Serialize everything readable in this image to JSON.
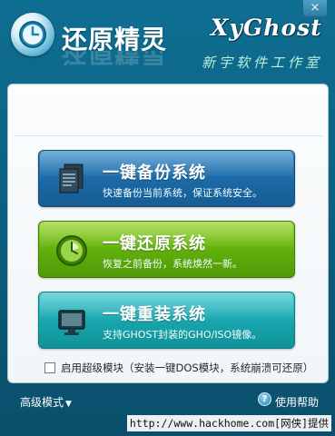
{
  "header": {
    "title": "还原精灵",
    "brand": "XyGhost",
    "brand_sub": "新宇软件工作室",
    "close_label": "×"
  },
  "actions": [
    {
      "title": "一键备份系统",
      "desc": "快速备份当前系统，保证系统安全。",
      "icon": "documents-icon"
    },
    {
      "title": "一键还原系统",
      "desc": "恢复之前备份，系统焕然一新。",
      "icon": "clock-icon"
    },
    {
      "title": "一键重装系统",
      "desc": "支持GHOST封装的GHO/ISO镜像。",
      "icon": "monitor-icon"
    }
  ],
  "options": {
    "dos_module_label": "启用超级模块（安装一键DOS模块，系统崩溃可还原）",
    "dos_module_checked": false
  },
  "footer": {
    "mode_label": "高级模式",
    "mode_caret": "▼",
    "help_label": "使用帮助",
    "help_glyph": "?"
  },
  "watermark": "http://www.hackhome.com[网侠]提供",
  "colors": {
    "backup_button": "#1b69a6",
    "restore_button": "#5fae0c",
    "reinstall_button": "#17a4ac",
    "window_bg": "#0f6f93"
  }
}
